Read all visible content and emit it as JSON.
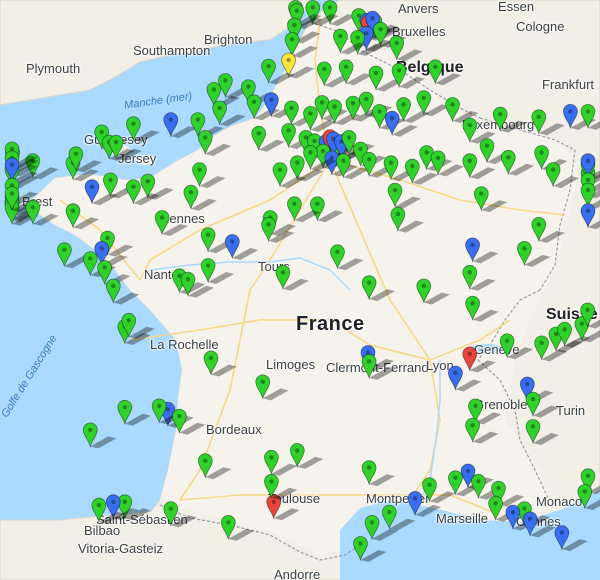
{
  "map": {
    "colors": {
      "sea": "#aadaff",
      "land": "#f1efe6",
      "land_france": "#f5f3ec",
      "border": "#9a9aa6",
      "road": "#f8d57e",
      "pin_green": "#2fd12a",
      "pin_blue": "#3a6ef0",
      "pin_red": "#e8463c",
      "pin_yellow": "#f4e63a"
    },
    "labels": {
      "countries": {
        "belgique": "Belgique",
        "france": "France",
        "luxembourg": "Luxembourg",
        "suisse": "Suisse",
        "monaco": "Monaco",
        "andorre": "Andorre"
      },
      "water": {
        "manche": "Manche (mer)",
        "gascogne": "Golfe de Gascogne"
      },
      "cities": {
        "anvers": "Anvers",
        "essen": "Essen",
        "bruxelles": "Bruxelles",
        "cologne": "Cologne",
        "frankfurt": "Frankfurt",
        "plymouth": "Plymouth",
        "brighton": "Brighton",
        "southampton": "Southampton",
        "guernesey": "Guernesey",
        "jersey": "Jersey",
        "brest": "Brest",
        "rennes": "Rennes",
        "nantes": "Nantes",
        "tours": "Tours",
        "la_rochelle": "La Rochelle",
        "limoges": "Limoges",
        "clermont": "Clermont-Ferrand",
        "lyon": "Lyon",
        "geneve": "Genève",
        "grenoble": "Grenoble",
        "turin": "Turin",
        "bordeaux": "Bordeaux",
        "toulouse": "Toulouse",
        "montpellier": "Montpellier",
        "marseille": "Marseille",
        "cannes": "Cannes",
        "bilbao": "Bilbao",
        "saint_sebastien": "Saint-Sébastien",
        "vitoria": "Vitoria-Gasteiz"
      }
    },
    "pins": [
      {
        "color": "green",
        "lon": 2.42,
        "lat": 51.05
      },
      {
        "color": "green",
        "lon": 2.12,
        "lat": 50.99
      },
      {
        "color": "green",
        "lon": 1.82,
        "lat": 50.93
      },
      {
        "color": "green",
        "lon": 1.84,
        "lat": 50.77
      },
      {
        "color": "green",
        "lon": 1.8,
        "lat": 50.56
      },
      {
        "color": "green",
        "lon": 1.76,
        "lat": 50.35
      },
      {
        "color": "green",
        "lon": 2.92,
        "lat": 50.7
      },
      {
        "color": "blue",
        "lon": 3.06,
        "lat": 50.63
      },
      {
        "color": "red",
        "lon": 3.08,
        "lat": 50.6
      },
      {
        "color": "green",
        "lon": 3.2,
        "lat": 50.62
      },
      {
        "color": "blue",
        "lon": 3.16,
        "lat": 50.66
      },
      {
        "color": "green",
        "lon": 3.3,
        "lat": 50.5
      },
      {
        "color": "blue",
        "lon": 3.05,
        "lat": 50.44
      },
      {
        "color": "green",
        "lon": 2.9,
        "lat": 50.38
      },
      {
        "color": "green",
        "lon": 2.6,
        "lat": 50.4
      },
      {
        "color": "green",
        "lon": 3.58,
        "lat": 50.3
      },
      {
        "color": "yellow",
        "lon": 1.7,
        "lat": 50.05
      },
      {
        "color": "green",
        "lon": 1.35,
        "lat": 49.96
      },
      {
        "color": "green",
        "lon": 2.32,
        "lat": 49.92
      },
      {
        "color": "green",
        "lon": 2.7,
        "lat": 49.95
      },
      {
        "color": "green",
        "lon": 3.22,
        "lat": 49.86
      },
      {
        "color": "green",
        "lon": 3.62,
        "lat": 49.9
      },
      {
        "color": "green",
        "lon": 4.25,
        "lat": 49.95
      },
      {
        "color": "green",
        "lon": 0.4,
        "lat": 49.62
      },
      {
        "color": "green",
        "lon": 0.6,
        "lat": 49.75
      },
      {
        "color": "green",
        "lon": 1.0,
        "lat": 49.66
      },
      {
        "color": "green",
        "lon": 1.1,
        "lat": 49.44
      },
      {
        "color": "green",
        "lon": 0.5,
        "lat": 49.35
      },
      {
        "color": "blue",
        "lon": 1.4,
        "lat": 49.47
      },
      {
        "color": "green",
        "lon": 1.75,
        "lat": 49.35
      },
      {
        "color": "green",
        "lon": 2.08,
        "lat": 49.27
      },
      {
        "color": "green",
        "lon": 2.28,
        "lat": 49.43
      },
      {
        "color": "green",
        "lon": 2.5,
        "lat": 49.37
      },
      {
        "color": "green",
        "lon": 2.82,
        "lat": 49.42
      },
      {
        "color": "green",
        "lon": 3.05,
        "lat": 49.48
      },
      {
        "color": "green",
        "lon": 3.28,
        "lat": 49.3
      },
      {
        "color": "blue",
        "lon": 3.5,
        "lat": 49.2
      },
      {
        "color": "green",
        "lon": 3.7,
        "lat": 49.4
      },
      {
        "color": "green",
        "lon": 4.05,
        "lat": 49.5
      },
      {
        "color": "green",
        "lon": 4.55,
        "lat": 49.4
      },
      {
        "color": "green",
        "lon": 4.85,
        "lat": 49.1
      },
      {
        "color": "green",
        "lon": 5.38,
        "lat": 49.26
      },
      {
        "color": "green",
        "lon": 6.05,
        "lat": 49.22
      },
      {
        "color": "blue",
        "lon": 6.6,
        "lat": 49.3
      },
      {
        "color": "green",
        "lon": 7.05,
        "lat": 49.3
      },
      {
        "color": "blue",
        "lon": -0.35,
        "lat": 49.18
      },
      {
        "color": "green",
        "lon": -1.0,
        "lat": 49.12
      },
      {
        "color": "green",
        "lon": -1.55,
        "lat": 49.0
      },
      {
        "color": "green",
        "lon": -1.42,
        "lat": 48.85
      },
      {
        "color": "green",
        "lon": 0.12,
        "lat": 49.18
      },
      {
        "color": "green",
        "lon": 0.25,
        "lat": 48.92
      },
      {
        "color": "green",
        "lon": 1.18,
        "lat": 48.98
      },
      {
        "color": "green",
        "lon": 1.7,
        "lat": 49.02
      },
      {
        "color": "green",
        "lon": 2.0,
        "lat": 48.92
      },
      {
        "color": "green",
        "lon": 2.15,
        "lat": 48.87
      },
      {
        "color": "blue",
        "lon": 2.35,
        "lat": 48.86
      },
      {
        "color": "red",
        "lon": 2.42,
        "lat": 48.93
      },
      {
        "color": "green",
        "lon": 2.52,
        "lat": 48.82
      },
      {
        "color": "blue",
        "lon": 2.48,
        "lat": 48.9
      },
      {
        "color": "blue",
        "lon": 2.62,
        "lat": 48.86
      },
      {
        "color": "green",
        "lon": 2.75,
        "lat": 48.92
      },
      {
        "color": "green",
        "lon": 2.3,
        "lat": 48.72
      },
      {
        "color": "blue",
        "lon": 2.45,
        "lat": 48.62
      },
      {
        "color": "green",
        "lon": 2.65,
        "lat": 48.58
      },
      {
        "color": "green",
        "lon": 2.08,
        "lat": 48.7
      },
      {
        "color": "green",
        "lon": 1.85,
        "lat": 48.55
      },
      {
        "color": "green",
        "lon": 1.55,
        "lat": 48.45
      },
      {
        "color": "green",
        "lon": 2.95,
        "lat": 48.75
      },
      {
        "color": "green",
        "lon": 3.1,
        "lat": 48.6
      },
      {
        "color": "green",
        "lon": 3.48,
        "lat": 48.55
      },
      {
        "color": "green",
        "lon": 3.85,
        "lat": 48.5
      },
      {
        "color": "green",
        "lon": 4.1,
        "lat": 48.7
      },
      {
        "color": "green",
        "lon": 4.3,
        "lat": 48.62
      },
      {
        "color": "green",
        "lon": 4.85,
        "lat": 48.58
      },
      {
        "color": "green",
        "lon": 5.15,
        "lat": 48.8
      },
      {
        "color": "green",
        "lon": 5.52,
        "lat": 48.63
      },
      {
        "color": "green",
        "lon": 6.1,
        "lat": 48.7
      },
      {
        "color": "green",
        "lon": 6.3,
        "lat": 48.45
      },
      {
        "color": "green",
        "lon": 7.15,
        "lat": 48.4
      },
      {
        "color": "green",
        "lon": 7.45,
        "lat": 48.53
      },
      {
        "color": "blue",
        "lon": 7.62,
        "lat": 48.58
      },
      {
        "color": "green",
        "lon": 7.75,
        "lat": 48.3
      },
      {
        "color": "green",
        "lon": 7.45,
        "lat": 48.15
      },
      {
        "color": "blue",
        "lon": 7.35,
        "lat": 47.85
      },
      {
        "color": "green",
        "lon": 6.05,
        "lat": 47.65
      },
      {
        "color": "green",
        "lon": 5.05,
        "lat": 48.1
      },
      {
        "color": "green",
        "lon": 3.55,
        "lat": 48.15
      },
      {
        "color": "green",
        "lon": 3.6,
        "lat": 47.8
      },
      {
        "color": "green",
        "lon": 2.2,
        "lat": 47.95
      },
      {
        "color": "green",
        "lon": 1.8,
        "lat": 47.95
      },
      {
        "color": "green",
        "lon": 1.38,
        "lat": 47.75
      },
      {
        "color": "green",
        "lon": 0.15,
        "lat": 48.45
      },
      {
        "color": "green",
        "lon": 0.0,
        "lat": 48.12
      },
      {
        "color": "green",
        "lon": -0.75,
        "lat": 48.28
      },
      {
        "color": "green",
        "lon": -1.3,
        "lat": 48.85
      },
      {
        "color": "green",
        "lon": -2.05,
        "lat": 48.55
      },
      {
        "color": "green",
        "lon": -2.0,
        "lat": 48.68
      },
      {
        "color": "green",
        "lon": -2.75,
        "lat": 48.58
      },
      {
        "color": "green",
        "lon": -3.1,
        "lat": 48.7
      },
      {
        "color": "green",
        "lon": -3.55,
        "lat": 48.75
      },
      {
        "color": "green",
        "lon": -3.9,
        "lat": 48.62
      },
      {
        "color": "green",
        "lon": -4.15,
        "lat": 48.45
      },
      {
        "color": "blue",
        "lon": -4.5,
        "lat": 48.52
      },
      {
        "color": "green",
        "lon": -4.25,
        "lat": 48.22
      },
      {
        "color": "green",
        "lon": -4.35,
        "lat": 48.05
      },
      {
        "color": "green",
        "lon": -3.95,
        "lat": 47.98
      },
      {
        "color": "green",
        "lon": -4.12,
        "lat": 47.95
      },
      {
        "color": "green",
        "lon": -3.5,
        "lat": 47.9
      },
      {
        "color": "green",
        "lon": -3.25,
        "lat": 48.1
      },
      {
        "color": "green",
        "lon": -2.75,
        "lat": 47.9
      },
      {
        "color": "blue",
        "lon": -1.72,
        "lat": 48.2
      },
      {
        "color": "green",
        "lon": -1.4,
        "lat": 48.3
      },
      {
        "color": "green",
        "lon": -1.0,
        "lat": 48.2
      },
      {
        "color": "green",
        "lon": -2.05,
        "lat": 47.85
      },
      {
        "color": "green",
        "lon": -0.5,
        "lat": 47.75
      },
      {
        "color": "green",
        "lon": 0.3,
        "lat": 47.5
      },
      {
        "color": "blue",
        "lon": 0.72,
        "lat": 47.4
      },
      {
        "color": "green",
        "lon": 1.35,
        "lat": 47.65
      },
      {
        "color": "green",
        "lon": -1.45,
        "lat": 47.45
      },
      {
        "color": "blue",
        "lon": -1.55,
        "lat": 47.3
      },
      {
        "color": "green",
        "lon": -2.2,
        "lat": 47.28
      },
      {
        "color": "green",
        "lon": -1.75,
        "lat": 47.15
      },
      {
        "color": "green",
        "lon": -1.5,
        "lat": 47.02
      },
      {
        "color": "green",
        "lon": -1.35,
        "lat": 46.75
      },
      {
        "color": "green",
        "lon": -0.2,
        "lat": 46.9
      },
      {
        "color": "green",
        "lon": 0.3,
        "lat": 47.05
      },
      {
        "color": "green",
        "lon": -0.05,
        "lat": 46.85
      },
      {
        "color": "green",
        "lon": 1.6,
        "lat": 46.95
      },
      {
        "color": "green",
        "lon": 2.55,
        "lat": 47.25
      },
      {
        "color": "green",
        "lon": 3.1,
        "lat": 46.8
      },
      {
        "color": "green",
        "lon": 4.05,
        "lat": 46.75
      },
      {
        "color": "blue",
        "lon": 4.9,
        "lat": 47.35
      },
      {
        "color": "green",
        "lon": 5.8,
        "lat": 47.3
      },
      {
        "color": "green",
        "lon": 4.85,
        "lat": 46.95
      },
      {
        "color": "green",
        "lon": 4.9,
        "lat": 46.5
      },
      {
        "color": "green",
        "lon": -1.15,
        "lat": 46.16
      },
      {
        "color": "green",
        "lon": -1.08,
        "lat": 46.25
      },
      {
        "color": "green",
        "lon": 0.35,
        "lat": 45.7
      },
      {
        "color": "green",
        "lon": 1.25,
        "lat": 45.35
      },
      {
        "color": "blue",
        "lon": 3.08,
        "lat": 45.78
      },
      {
        "color": "green",
        "lon": 3.1,
        "lat": 45.65
      },
      {
        "color": "blue",
        "lon": 4.6,
        "lat": 45.48
      },
      {
        "color": "red",
        "lon": 4.85,
        "lat": 45.76
      },
      {
        "color": "green",
        "lon": 5.5,
        "lat": 45.95
      },
      {
        "color": "green",
        "lon": 6.1,
        "lat": 45.92
      },
      {
        "color": "green",
        "lon": 6.35,
        "lat": 46.05
      },
      {
        "color": "green",
        "lon": 6.5,
        "lat": 46.12
      },
      {
        "color": "green",
        "lon": 6.8,
        "lat": 46.2
      },
      {
        "color": "green",
        "lon": 6.9,
        "lat": 46.4
      },
      {
        "color": "blue",
        "lon": 5.85,
        "lat": 45.32
      },
      {
        "color": "green",
        "lon": 5.95,
        "lat": 45.1
      },
      {
        "color": "green",
        "lon": 4.95,
        "lat": 45.0
      },
      {
        "color": "green",
        "lon": 4.9,
        "lat": 44.72
      },
      {
        "color": "green",
        "lon": 5.95,
        "lat": 44.7
      },
      {
        "color": "green",
        "lon": -1.15,
        "lat": 44.98
      },
      {
        "color": "blue",
        "lon": -0.4,
        "lat": 44.95
      },
      {
        "color": "green",
        "lon": -0.55,
        "lat": 45.0
      },
      {
        "color": "green",
        "lon": -0.2,
        "lat": 44.85
      },
      {
        "color": "green",
        "lon": -1.75,
        "lat": 44.65
      },
      {
        "color": "green",
        "lon": 0.25,
        "lat": 44.2
      },
      {
        "color": "green",
        "lon": 1.85,
        "lat": 44.35
      },
      {
        "color": "green",
        "lon": 1.4,
        "lat": 44.25
      },
      {
        "color": "green",
        "lon": 3.1,
        "lat": 44.1
      },
      {
        "color": "blue",
        "lon": 4.82,
        "lat": 44.05
      },
      {
        "color": "green",
        "lon": 4.15,
        "lat": 43.85
      },
      {
        "color": "green",
        "lon": 4.6,
        "lat": 43.95
      },
      {
        "color": "green",
        "lon": 5.0,
        "lat": 43.9
      },
      {
        "color": "green",
        "lon": 5.35,
        "lat": 43.8
      },
      {
        "color": "green",
        "lon": 7.3,
        "lat": 43.98
      },
      {
        "color": "green",
        "lon": 6.85,
        "lat": 43.75
      },
      {
        "color": "blue",
        "lon": 3.9,
        "lat": 43.65
      },
      {
        "color": "green",
        "lon": 5.3,
        "lat": 43.58
      },
      {
        "color": "green",
        "lon": 5.8,
        "lat": 43.5
      },
      {
        "color": "blue",
        "lon": 5.6,
        "lat": 43.45
      },
      {
        "color": "blue",
        "lon": 5.9,
        "lat": 43.35
      },
      {
        "color": "blue",
        "lon": 6.45,
        "lat": 43.15
      },
      {
        "color": "green",
        "lon": 3.45,
        "lat": 43.45
      },
      {
        "color": "green",
        "lon": 3.15,
        "lat": 43.3
      },
      {
        "color": "green",
        "lon": 2.95,
        "lat": 42.78
      },
      {
        "color": "red",
        "lon": 1.44,
        "lat": 43.6
      },
      {
        "color": "green",
        "lon": 1.4,
        "lat": 43.9
      },
      {
        "color": "green",
        "lon": 0.65,
        "lat": 43.3
      },
      {
        "color": "green",
        "lon": -0.35,
        "lat": 43.5
      },
      {
        "color": "green",
        "lon": -1.15,
        "lat": 43.6
      },
      {
        "color": "blue",
        "lon": -1.35,
        "lat": 43.6
      },
      {
        "color": "green",
        "lon": -1.6,
        "lat": 43.55
      }
    ]
  }
}
